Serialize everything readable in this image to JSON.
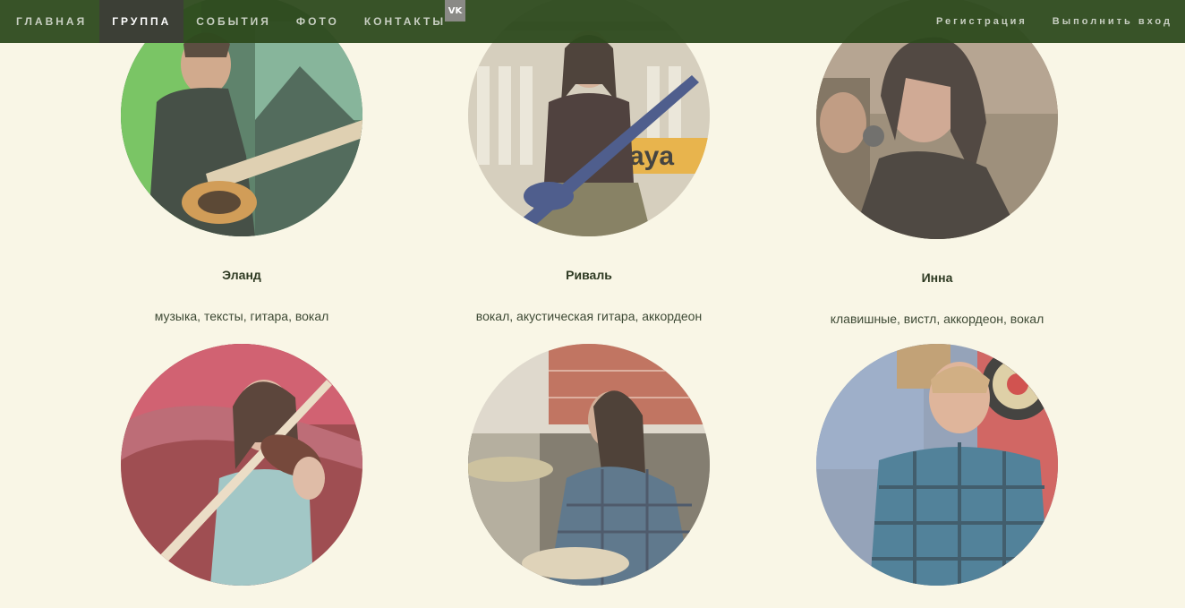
{
  "nav": {
    "items": [
      {
        "label": "Главная",
        "active": false
      },
      {
        "label": "Группа",
        "active": true
      },
      {
        "label": "События",
        "active": false
      },
      {
        "label": "Фото",
        "active": false
      },
      {
        "label": "Контакты",
        "active": false
      }
    ],
    "vk_label": "VK",
    "register": "Регистрация",
    "login": "Выполнить вход"
  },
  "members": [
    {
      "name": "Эланд",
      "role": "музыка, тексты, гитара, вокал"
    },
    {
      "name": "Риваль",
      "role": "вокал, акустическая гитара, аккордеон"
    },
    {
      "name": "Инна",
      "role": "клавишные, вистл, аккордеон, вокал"
    },
    {
      "name": "",
      "role": ""
    },
    {
      "name": "",
      "role": ""
    },
    {
      "name": "",
      "role": ""
    }
  ],
  "colors": {
    "page_bg": "#f9f6e6",
    "navbar_bg": "#2d4a1e",
    "nav_active_bg": "#3c3f36",
    "nav_text": "#c8cfc2",
    "vk_bg": "#8a8a86"
  }
}
